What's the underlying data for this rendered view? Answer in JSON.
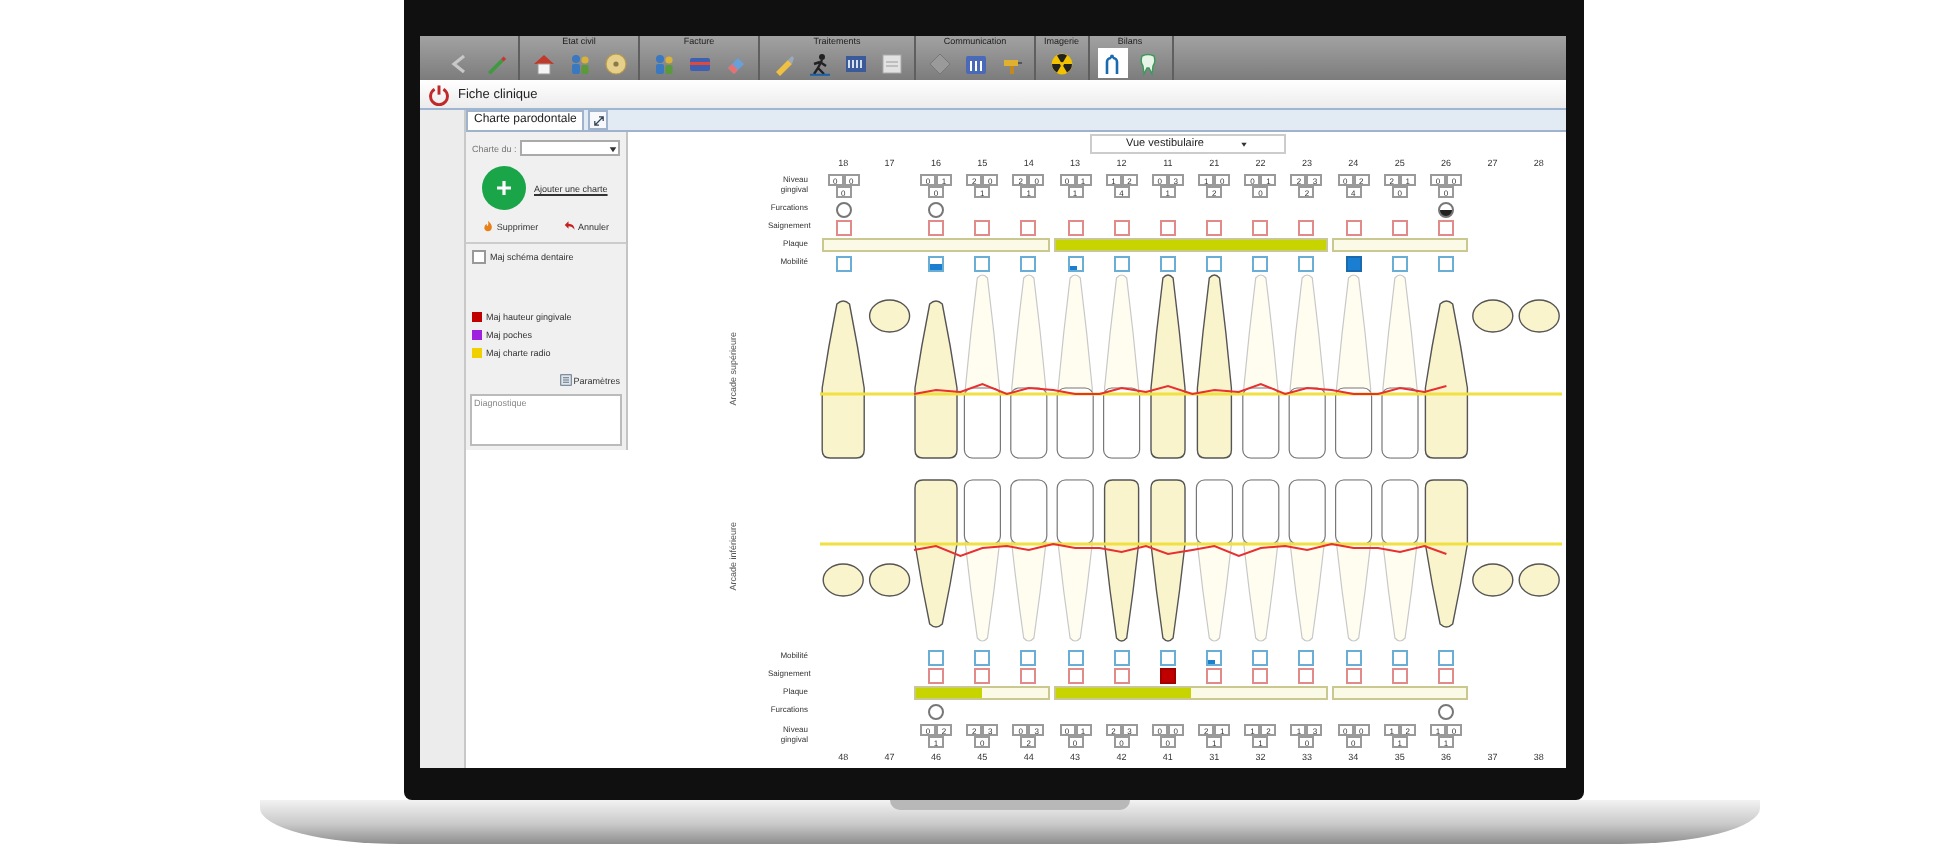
{
  "window": {
    "title": "Fiche clinique"
  },
  "toolbar": [
    {
      "tools": [
        {
          "kind": "back",
          "selected": false
        },
        {
          "kind": "pencil",
          "selected": false
        }
      ]
    },
    {
      "label": "Etat civil",
      "tools": [
        {
          "kind": "house",
          "selected": false
        },
        {
          "kind": "people",
          "selected": false
        },
        {
          "kind": "disc",
          "selected": false
        }
      ]
    },
    {
      "label": "Facture",
      "tools": [
        {
          "kind": "people",
          "selected": false
        },
        {
          "kind": "card",
          "selected": false
        },
        {
          "kind": "eraser",
          "selected": false
        }
      ]
    },
    {
      "label": "Traitements",
      "tools": [
        {
          "kind": "pen",
          "selected": false
        },
        {
          "kind": "figure",
          "selected": false
        },
        {
          "kind": "list",
          "selected": false
        },
        {
          "kind": "note",
          "selected": false
        }
      ]
    },
    {
      "label": "Communication",
      "tools": [
        {
          "kind": "diamond",
          "selected": false
        },
        {
          "kind": "calendar",
          "selected": false
        },
        {
          "kind": "drill",
          "selected": false
        }
      ]
    },
    {
      "label": "Imagerie",
      "tools": [
        {
          "kind": "radiation",
          "selected": false
        }
      ]
    },
    {
      "label": "Bilans",
      "tools": [
        {
          "kind": "probe",
          "selected": true
        },
        {
          "kind": "tooth",
          "selected": false
        }
      ]
    }
  ],
  "panel": {
    "tab": "Charte parodontale",
    "date_label": "Charte du :",
    "add_label": "Ajouter une charte",
    "delete": "Supprimer",
    "cancel": "Annuler",
    "option": {
      "label": "Maj schéma dentaire",
      "checked": false
    },
    "legend": [
      {
        "label": "Maj hauteur gingivale",
        "color": "#c00000"
      },
      {
        "label": "Maj poches",
        "color": "#a020e0"
      },
      {
        "label": "Maj charte radio",
        "color": "#f0d000"
      }
    ],
    "settings": "Paramètres",
    "notes_placeholder": "Diagnostique"
  },
  "chart": {
    "view": "Vue vestibulaire",
    "upper": {
      "label": "Arcade supérieure",
      "rows": [
        {
          "kind": "numbers"
        },
        {
          "kind": "gingival",
          "label": "Niveau gingival"
        },
        {
          "kind": "furcation",
          "label": "Furcations"
        },
        {
          "kind": "bleeding",
          "label": "Saignement"
        },
        {
          "kind": "plaque",
          "label": "Plaque"
        },
        {
          "kind": "mobility",
          "label": "Mobilité"
        }
      ],
      "sextants": [
        {
          "plaque": {
            "kind": "none"
          },
          "teeth": [
            {
              "number": "18",
              "gingival": [
                "0",
                "0"
              ],
              "depth": "0",
              "furcation": {
                "kind": "empty"
              },
              "bleeding": false,
              "mobility": {
                "kind": "none"
              }
            },
            {
              "number": "17"
            },
            {
              "number": "16",
              "gingival": [
                "0",
                "1"
              ],
              "depth": "0",
              "furcation": {
                "kind": "empty"
              },
              "bleeding": false,
              "mobility": {
                "kind": "moderate"
              }
            },
            {
              "number": "15",
              "gingival": [
                "2",
                "0"
              ],
              "depth": "1",
              "bleeding": false,
              "mobility": {
                "kind": "none"
              }
            },
            {
              "number": "14",
              "gingival": [
                "2",
                "0"
              ],
              "depth": "1",
              "bleeding": false,
              "mobility": {
                "kind": "none"
              }
            }
          ]
        },
        {
          "plaque": {
            "kind": "full"
          },
          "teeth": [
            {
              "number": "13",
              "gingival": [
                "0",
                "1"
              ],
              "depth": "1",
              "bleeding": false,
              "mobility": {
                "kind": "slight"
              }
            },
            {
              "number": "12",
              "gingival": [
                "1",
                "2"
              ],
              "depth": "4",
              "bleeding": false,
              "mobility": {
                "kind": "none"
              }
            },
            {
              "number": "11",
              "gingival": [
                "0",
                "3"
              ],
              "depth": "1",
              "bleeding": false,
              "mobility": {
                "kind": "none"
              }
            },
            {
              "number": "21",
              "gingival": [
                "1",
                "0"
              ],
              "depth": "2",
              "bleeding": false,
              "mobility": {
                "kind": "none"
              }
            },
            {
              "number": "22",
              "gingival": [
                "0",
                "1"
              ],
              "depth": "0",
              "bleeding": false,
              "mobility": {
                "kind": "none"
              }
            },
            {
              "number": "23",
              "gingival": [
                "2",
                "3"
              ],
              "depth": "2",
              "bleeding": false,
              "mobility": {
                "kind": "none"
              }
            }
          ]
        },
        {
          "plaque": {
            "kind": "none"
          },
          "teeth": [
            {
              "number": "24",
              "gingival": [
                "0",
                "2"
              ],
              "depth": "4",
              "bleeding": false,
              "mobility": {
                "kind": "severe"
              }
            },
            {
              "number": "25",
              "gingival": [
                "2",
                "1"
              ],
              "depth": "0",
              "bleeding": false,
              "mobility": {
                "kind": "none"
              }
            },
            {
              "number": "26",
              "gingival": [
                "0",
                "0"
              ],
              "depth": "0",
              "furcation": {
                "kind": "half"
              },
              "bleeding": false,
              "mobility": {
                "kind": "none"
              }
            },
            {
              "number": "27"
            },
            {
              "number": "28"
            }
          ]
        }
      ]
    },
    "lower": {
      "label": "Arcade inférieure",
      "rows": [
        {
          "kind": "mobility",
          "label": "Mobilité"
        },
        {
          "kind": "bleeding",
          "label": "Saignement"
        },
        {
          "kind": "plaque",
          "label": "Plaque"
        },
        {
          "kind": "furcation",
          "label": "Furcations"
        },
        {
          "kind": "gingival",
          "label": "Niveau gingival"
        },
        {
          "kind": "numbers"
        }
      ],
      "sextants": [
        {
          "plaque": {
            "kind": "half"
          },
          "teeth": [
            {
              "number": "48"
            },
            {
              "number": "47"
            },
            {
              "number": "46",
              "gingival": [
                "0",
                "2"
              ],
              "depth": "1",
              "furcation": {
                "kind": "empty"
              },
              "bleeding": false,
              "mobility": {
                "kind": "none"
              }
            },
            {
              "number": "45",
              "gingival": [
                "2",
                "3"
              ],
              "depth": "0",
              "bleeding": false,
              "mobility": {
                "kind": "none"
              }
            },
            {
              "number": "44",
              "gingival": [
                "0",
                "3"
              ],
              "depth": "2",
              "bleeding": false,
              "mobility": {
                "kind": "none"
              }
            }
          ]
        },
        {
          "plaque": {
            "kind": "half"
          },
          "teeth": [
            {
              "number": "43",
              "gingival": [
                "0",
                "1"
              ],
              "depth": "0",
              "bleeding": false,
              "mobility": {
                "kind": "none"
              }
            },
            {
              "number": "42",
              "gingival": [
                "2",
                "3"
              ],
              "depth": "0",
              "bleeding": false,
              "mobility": {
                "kind": "none"
              }
            },
            {
              "number": "41",
              "gingival": [
                "0",
                "0"
              ],
              "depth": "0",
              "bleeding": true,
              "mobility": {
                "kind": "none"
              }
            },
            {
              "number": "31",
              "gingival": [
                "2",
                "1"
              ],
              "depth": "1",
              "bleeding": false,
              "mobility": {
                "kind": "slight"
              }
            },
            {
              "number": "32",
              "gingival": [
                "1",
                "2"
              ],
              "depth": "1",
              "bleeding": false,
              "mobility": {
                "kind": "none"
              }
            },
            {
              "number": "33",
              "gingival": [
                "1",
                "3"
              ],
              "depth": "0",
              "bleeding": false,
              "mobility": {
                "kind": "none"
              }
            }
          ]
        },
        {
          "plaque": {
            "kind": "none"
          },
          "teeth": [
            {
              "number": "34",
              "gingival": [
                "0",
                "0"
              ],
              "depth": "0",
              "bleeding": false,
              "mobility": {
                "kind": "none"
              }
            },
            {
              "number": "35",
              "gingival": [
                "1",
                "2"
              ],
              "depth": "1",
              "bleeding": false,
              "mobility": {
                "kind": "none"
              }
            },
            {
              "number": "36",
              "gingival": [
                "1",
                "0"
              ],
              "depth": "1",
              "furcation": {
                "kind": "empty"
              },
              "bleeding": false,
              "mobility": {
                "kind": "none"
              }
            },
            {
              "number": "37"
            },
            {
              "number": "38"
            }
          ]
        }
      ]
    }
  }
}
